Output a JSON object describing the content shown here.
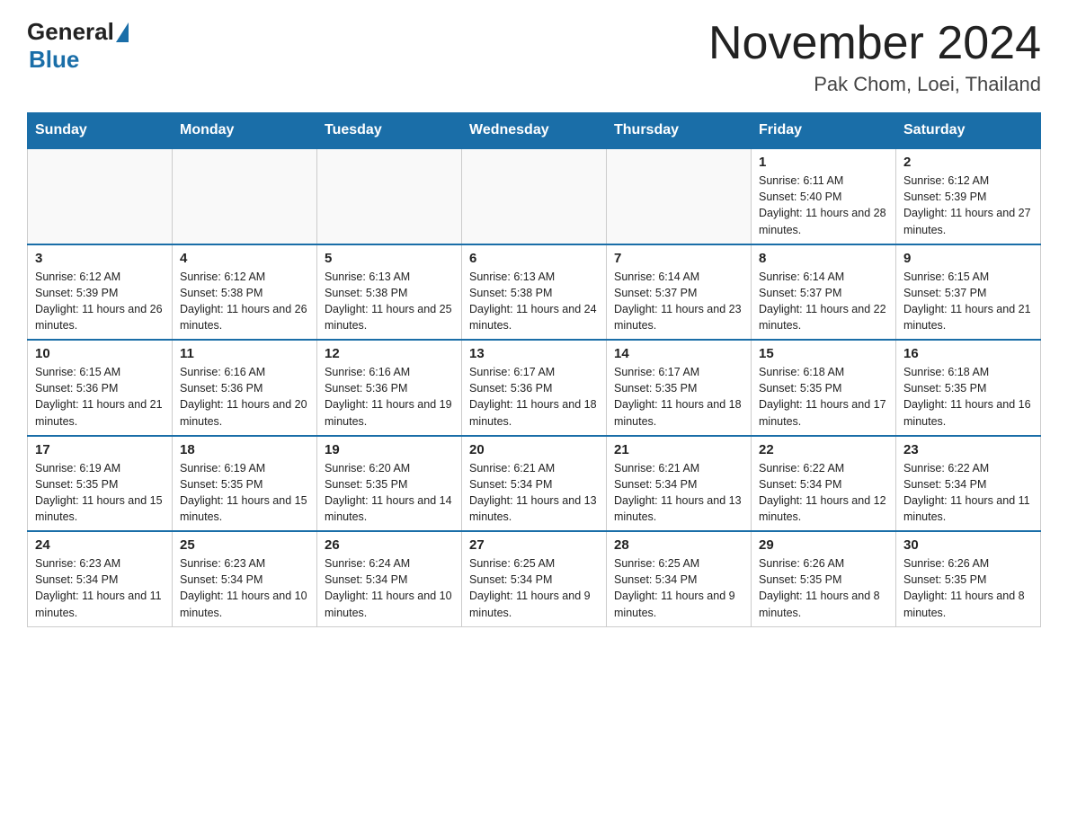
{
  "logo": {
    "general": "General",
    "blue": "Blue"
  },
  "title": {
    "month_year": "November 2024",
    "location": "Pak Chom, Loei, Thailand"
  },
  "weekdays": [
    "Sunday",
    "Monday",
    "Tuesday",
    "Wednesday",
    "Thursday",
    "Friday",
    "Saturday"
  ],
  "weeks": [
    [
      {
        "day": "",
        "info": ""
      },
      {
        "day": "",
        "info": ""
      },
      {
        "day": "",
        "info": ""
      },
      {
        "day": "",
        "info": ""
      },
      {
        "day": "",
        "info": ""
      },
      {
        "day": "1",
        "info": "Sunrise: 6:11 AM\nSunset: 5:40 PM\nDaylight: 11 hours and 28 minutes."
      },
      {
        "day": "2",
        "info": "Sunrise: 6:12 AM\nSunset: 5:39 PM\nDaylight: 11 hours and 27 minutes."
      }
    ],
    [
      {
        "day": "3",
        "info": "Sunrise: 6:12 AM\nSunset: 5:39 PM\nDaylight: 11 hours and 26 minutes."
      },
      {
        "day": "4",
        "info": "Sunrise: 6:12 AM\nSunset: 5:38 PM\nDaylight: 11 hours and 26 minutes."
      },
      {
        "day": "5",
        "info": "Sunrise: 6:13 AM\nSunset: 5:38 PM\nDaylight: 11 hours and 25 minutes."
      },
      {
        "day": "6",
        "info": "Sunrise: 6:13 AM\nSunset: 5:38 PM\nDaylight: 11 hours and 24 minutes."
      },
      {
        "day": "7",
        "info": "Sunrise: 6:14 AM\nSunset: 5:37 PM\nDaylight: 11 hours and 23 minutes."
      },
      {
        "day": "8",
        "info": "Sunrise: 6:14 AM\nSunset: 5:37 PM\nDaylight: 11 hours and 22 minutes."
      },
      {
        "day": "9",
        "info": "Sunrise: 6:15 AM\nSunset: 5:37 PM\nDaylight: 11 hours and 21 minutes."
      }
    ],
    [
      {
        "day": "10",
        "info": "Sunrise: 6:15 AM\nSunset: 5:36 PM\nDaylight: 11 hours and 21 minutes."
      },
      {
        "day": "11",
        "info": "Sunrise: 6:16 AM\nSunset: 5:36 PM\nDaylight: 11 hours and 20 minutes."
      },
      {
        "day": "12",
        "info": "Sunrise: 6:16 AM\nSunset: 5:36 PM\nDaylight: 11 hours and 19 minutes."
      },
      {
        "day": "13",
        "info": "Sunrise: 6:17 AM\nSunset: 5:36 PM\nDaylight: 11 hours and 18 minutes."
      },
      {
        "day": "14",
        "info": "Sunrise: 6:17 AM\nSunset: 5:35 PM\nDaylight: 11 hours and 18 minutes."
      },
      {
        "day": "15",
        "info": "Sunrise: 6:18 AM\nSunset: 5:35 PM\nDaylight: 11 hours and 17 minutes."
      },
      {
        "day": "16",
        "info": "Sunrise: 6:18 AM\nSunset: 5:35 PM\nDaylight: 11 hours and 16 minutes."
      }
    ],
    [
      {
        "day": "17",
        "info": "Sunrise: 6:19 AM\nSunset: 5:35 PM\nDaylight: 11 hours and 15 minutes."
      },
      {
        "day": "18",
        "info": "Sunrise: 6:19 AM\nSunset: 5:35 PM\nDaylight: 11 hours and 15 minutes."
      },
      {
        "day": "19",
        "info": "Sunrise: 6:20 AM\nSunset: 5:35 PM\nDaylight: 11 hours and 14 minutes."
      },
      {
        "day": "20",
        "info": "Sunrise: 6:21 AM\nSunset: 5:34 PM\nDaylight: 11 hours and 13 minutes."
      },
      {
        "day": "21",
        "info": "Sunrise: 6:21 AM\nSunset: 5:34 PM\nDaylight: 11 hours and 13 minutes."
      },
      {
        "day": "22",
        "info": "Sunrise: 6:22 AM\nSunset: 5:34 PM\nDaylight: 11 hours and 12 minutes."
      },
      {
        "day": "23",
        "info": "Sunrise: 6:22 AM\nSunset: 5:34 PM\nDaylight: 11 hours and 11 minutes."
      }
    ],
    [
      {
        "day": "24",
        "info": "Sunrise: 6:23 AM\nSunset: 5:34 PM\nDaylight: 11 hours and 11 minutes."
      },
      {
        "day": "25",
        "info": "Sunrise: 6:23 AM\nSunset: 5:34 PM\nDaylight: 11 hours and 10 minutes."
      },
      {
        "day": "26",
        "info": "Sunrise: 6:24 AM\nSunset: 5:34 PM\nDaylight: 11 hours and 10 minutes."
      },
      {
        "day": "27",
        "info": "Sunrise: 6:25 AM\nSunset: 5:34 PM\nDaylight: 11 hours and 9 minutes."
      },
      {
        "day": "28",
        "info": "Sunrise: 6:25 AM\nSunset: 5:34 PM\nDaylight: 11 hours and 9 minutes."
      },
      {
        "day": "29",
        "info": "Sunrise: 6:26 AM\nSunset: 5:35 PM\nDaylight: 11 hours and 8 minutes."
      },
      {
        "day": "30",
        "info": "Sunrise: 6:26 AM\nSunset: 5:35 PM\nDaylight: 11 hours and 8 minutes."
      }
    ]
  ]
}
